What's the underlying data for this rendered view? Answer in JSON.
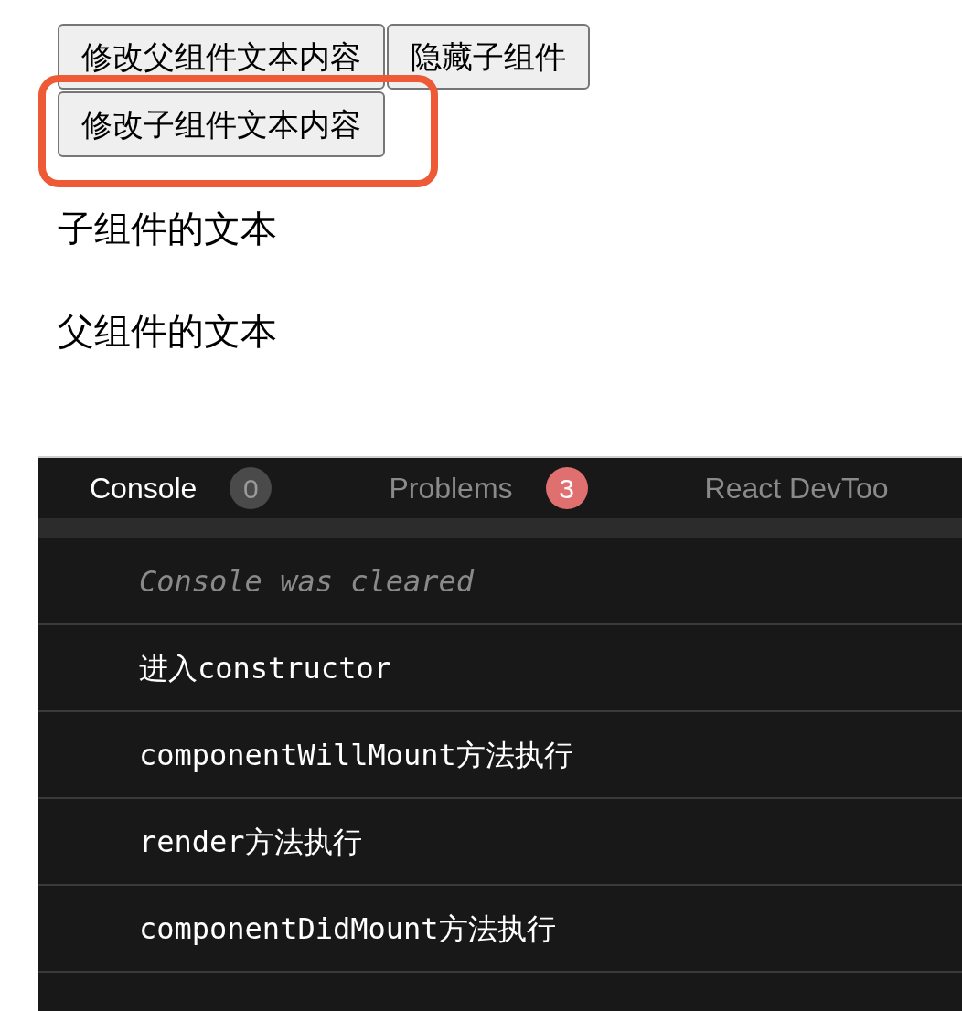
{
  "button_rows": [
    {
      "highlighted": false,
      "buttons": [
        "修改父组件文本内容",
        "隐藏子组件"
      ]
    },
    {
      "highlighted": true,
      "buttons": [
        "修改子组件文本内容"
      ]
    }
  ],
  "paragraphs": [
    "子组件的文本",
    "父组件的文本"
  ],
  "devtools": {
    "tabs": [
      {
        "label": "Console",
        "selected": true,
        "badge": "0",
        "color": "#4a4a4a"
      },
      {
        "label": "Problems",
        "selected": false,
        "badge": "3",
        "color": "#e07070"
      },
      {
        "label": "React DevToo",
        "selected": false
      }
    ],
    "console_lines": [
      {
        "kind": "info",
        "text": "Console was cleared"
      },
      {
        "kind": "log",
        "text": "进入constructor"
      },
      {
        "kind": "log",
        "text": "componentWillMount方法执行"
      },
      {
        "kind": "log",
        "text": "render方法执行"
      },
      {
        "kind": "log",
        "text": "componentDidMount方法执行"
      }
    ]
  }
}
